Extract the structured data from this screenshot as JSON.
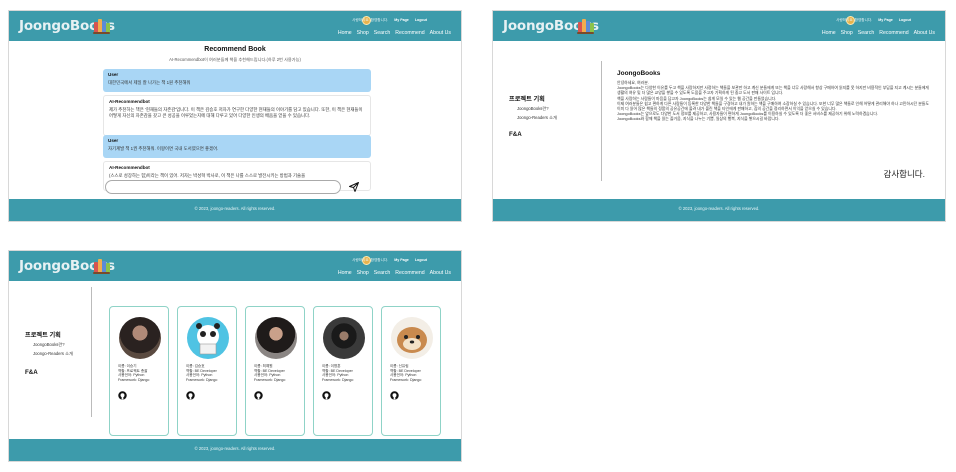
{
  "header": {
    "logo": "JoongoBooks",
    "greeting": "사랑하지요, 환영합니다.",
    "my_page": "My Page",
    "logout": "Logout",
    "nav": [
      "Home",
      "Shop",
      "Search",
      "Recommend",
      "About Us"
    ]
  },
  "footer": {
    "copyright": "© 2023, joongo-readers. All rights reserved."
  },
  "recommend": {
    "title": "Recommend Book",
    "subtitle": "AI-Recommendbot이 여러분들께 책을 추천해드립니다.(하루 2번 사용가능)",
    "messages": [
      {
        "role": "User",
        "text": "대한민국에서 제일 잘 나가는 책 1원 추천해줘"
      },
      {
        "role": "AI-Recommendbot",
        "text": "제가 추천하는 책은 '현재들의 자존감'입니다. 이 책은 김승호 저자가 연구한 다양한 현재들의 이야기를 담고 있습니다. 또한, 이 책은 현재들이 어떻게 자신의 자존감을 갖고 큰 성공을 이루었는지에 대해 다루고 있어 다양한 인생의 배움을 얻을 수 있습니다."
      },
      {
        "role": "User",
        "text": "자기계발 책 1권 추천해줘. 이왕이면 국내 도서였으면 좋겠어."
      },
      {
        "role": "AI-Recommendbot",
        "text": "(스스로 성장하는 힘)이라는 책이 있어. 저자는 박성혁 박사로, 이 책은 나를 스스로 발전시키는 방법과 기술을"
      }
    ],
    "input_value": ""
  },
  "sidebar": {
    "heading": "프로젝트 기획",
    "items": [
      "JoongoBooks란?",
      "Joongo-Readers 소개"
    ],
    "faq": "F&A"
  },
  "about": {
    "title": "JoongoBooks",
    "paragraphs": [
      "안녕하세요, 여러분.",
      "JoongoBooks는 다양한 이유를 두고 책을 사랑하지만 사정하는 책들을 보관만 하고 계신 분들에게 또는 책을 너무 사랑해서 항상 구매하여 읽지를 못 하지만 비용적인 부담을 지고 계시는 분들에게 생활의 여유 및 더 많은 교양을 쌓을 수 있도록 도움을 주고자 기획하게 된 중고 도서 판매 사이트 입니다.",
      "책을 사랑하는 사람들이 마음을 담고자 JoongoBooks는 쉽게 모일 수 있는 웹 공간을 만들었습니다.",
      "이제 여러분들은 쉽고 편하게 다른 사람들이 등록한 다양한 책들을 구경하고 내가 원하는 책을 구매하여 소장하실 수 있습니다. 또한 너무 많은 책들로 인해 어떻게 관리해야 하나 고민하시던 분들도 이미 다 읽어 많은 책들의 정품의 공유공간에 올려 내가 올린 책을 타인에게 판매하고, 집의 공간을 정리하면서 이익을 얻으실 수 있습니다.",
      "JoongoBooks는 앞으로도 다양한 도서 정보를 제공하고, 사용자들이 편하게 JoongoBooks를 이용하실 수 있도록 더 좋은 서비스를 제공하기 위해 노력하겠습니다.",
      "JoongoBooks와 함께 책을 읽는 즐거움, 지식을 나누는 기쁨, 일상의 행복, 지식을 쌓으시길 바랍니다."
    ],
    "thanks": "감사합니다."
  },
  "team": [
    {
      "name": "이름: 이승기",
      "role": "역할: 프로젝트 총괄",
      "lang": "사용언어: Python",
      "fw": "Framework: Django"
    },
    {
      "name": "이름: 김승호",
      "role": "역할: BE Developer",
      "lang": "사용언어: Python",
      "fw": "Framework: Django"
    },
    {
      "name": "이름: 최예원",
      "role": "역할: BE Developer",
      "lang": "사용언어: Python",
      "fw": "Framework: Django"
    },
    {
      "name": "이름: 이명훈",
      "role": "역할: BE Developer",
      "lang": "사용언어: Python",
      "fw": "Framework: Django"
    },
    {
      "name": "이름: 신유림",
      "role": "역할: BE Developer",
      "lang": "사용언어: Python",
      "fw": "Framework: Django"
    }
  ],
  "colors": {
    "brand": "#3d9bab",
    "user_bubble": "#a9d6f5",
    "card_border": "#8fd3c7"
  }
}
